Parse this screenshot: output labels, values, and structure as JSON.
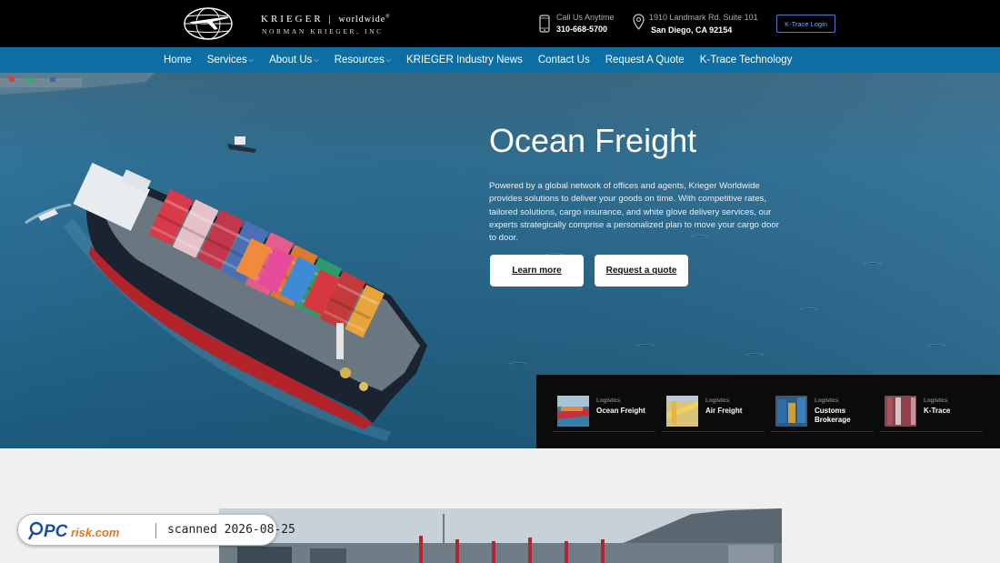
{
  "header": {
    "logo": {
      "line1_brand": "KRIEGER",
      "line1_suffix": "worldwide",
      "line2": "NORMAN KRIEGER, INC"
    },
    "contact": {
      "label": "Call Us Anytime",
      "phone": "310-668-5700",
      "icon": "phone-icon"
    },
    "address": {
      "line1": "1910 Landmark Rd. Suite 101",
      "line2": "San Diego, CA 92154",
      "icon": "map-pin-icon"
    },
    "ktrace_login": "K-Trace Login"
  },
  "nav": {
    "items": [
      {
        "label": "Home",
        "dropdown": false
      },
      {
        "label": "Services",
        "dropdown": true
      },
      {
        "label": "About Us",
        "dropdown": true
      },
      {
        "label": "Resources",
        "dropdown": true
      },
      {
        "label": "KRIEGER Industry News",
        "dropdown": false
      },
      {
        "label": "Contact Us",
        "dropdown": false
      },
      {
        "label": "Request A Quote",
        "dropdown": false
      },
      {
        "label": "K-Trace Technology",
        "dropdown": false
      }
    ],
    "chevron": "⌵"
  },
  "hero": {
    "title": "Ocean Freight",
    "text": "Powered by a global network of offices and agents, Krieger Worldwide provides solutions to deliver your goods on time. With competitive rates, tailored solutions, cargo insurance, and white glove delivery services, our experts strategically comprise a personalized plan to move your cargo door to door.",
    "buttons": {
      "learn_more": "Learn more",
      "request_quote": "Request a quote"
    }
  },
  "services": [
    {
      "category": "Logistics",
      "name": "Ocean Freight"
    },
    {
      "category": "Logistics",
      "name": "Air Freight"
    },
    {
      "category": "Logistics",
      "name": "Customs Brokerage"
    },
    {
      "category": "Logistics",
      "name": "K-Trace"
    }
  ],
  "watermark": {
    "brand": "PCrisk.com",
    "text": "scanned 2026-08-25"
  },
  "colors": {
    "nav_bg": "#0c6ea3",
    "top_bg": "#000000",
    "panel_bg": "#0b0b0b",
    "login_border": "#4a7fd0"
  }
}
